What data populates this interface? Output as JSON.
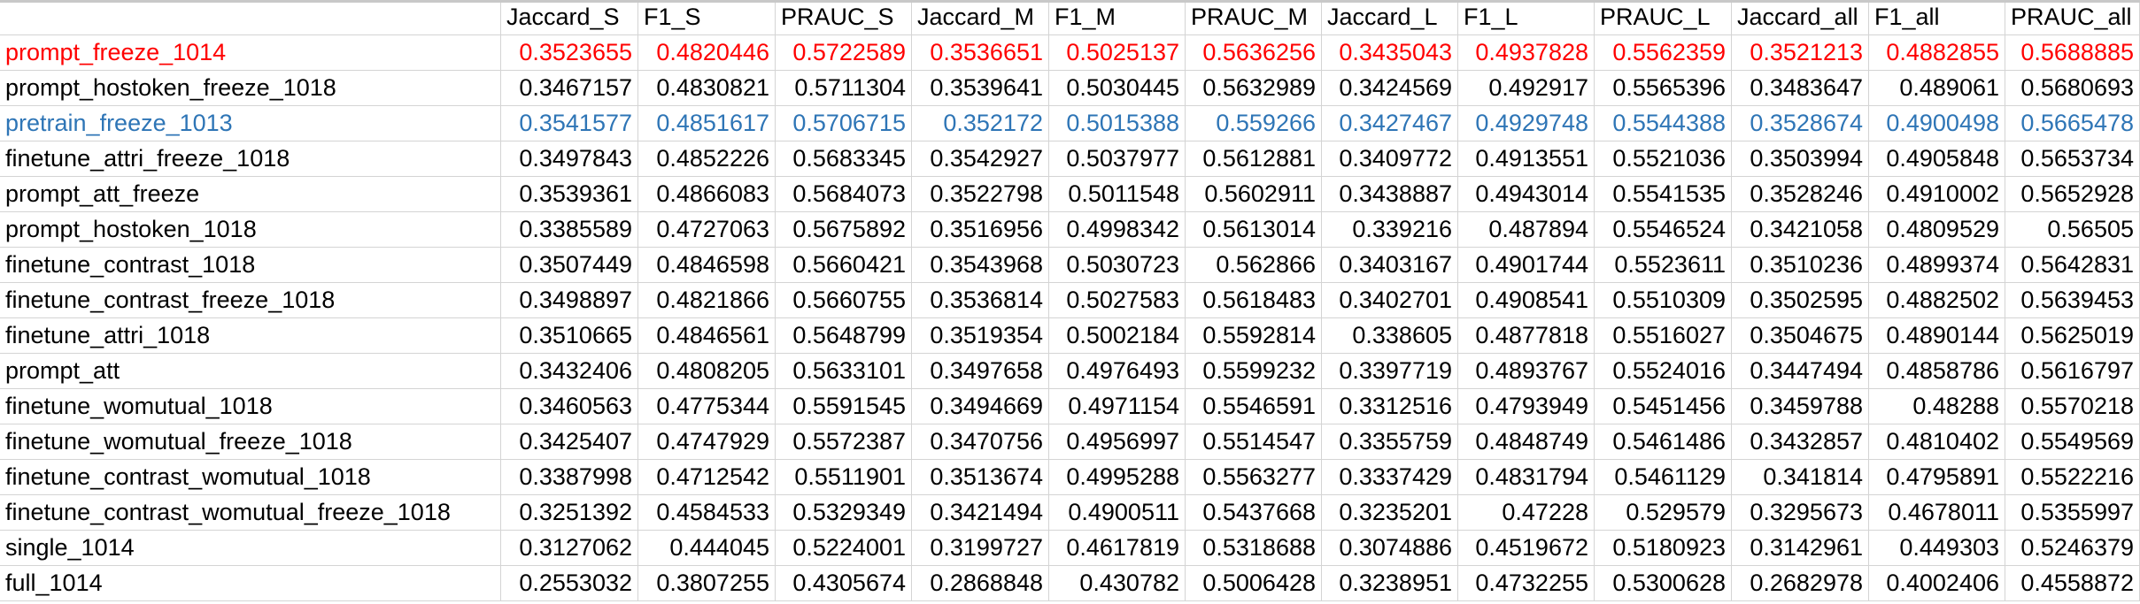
{
  "columns": [
    "Jaccard_S",
    "F1_S",
    "PRAUC_S",
    "Jaccard_M",
    "F1_M",
    "PRAUC_M",
    "Jaccard_L",
    "F1_L",
    "PRAUC_L",
    "Jaccard_all",
    "F1_all",
    "PRAUC_all"
  ],
  "colors": {
    "red": "#ff0000",
    "blue": "#2e75b6",
    "default": "#000000"
  },
  "rows": [
    {
      "name": "prompt_freeze_1014",
      "color": "#ff0000",
      "values": [
        "0.3523655",
        "0.4820446",
        "0.5722589",
        "0.3536651",
        "0.5025137",
        "0.5636256",
        "0.3435043",
        "0.4937828",
        "0.5562359",
        "0.3521213",
        "0.4882855",
        "0.5688885"
      ]
    },
    {
      "name": "prompt_hostoken_freeze_1018",
      "color": "#000000",
      "values": [
        "0.3467157",
        "0.4830821",
        "0.5711304",
        "0.3539641",
        "0.5030445",
        "0.5632989",
        "0.3424569",
        "0.492917",
        "0.5565396",
        "0.3483647",
        "0.489061",
        "0.5680693"
      ]
    },
    {
      "name": "pretrain_freeze_1013",
      "color": "#2e75b6",
      "values": [
        "0.3541577",
        "0.4851617",
        "0.5706715",
        "0.352172",
        "0.5015388",
        "0.559266",
        "0.3427467",
        "0.4929748",
        "0.5544388",
        "0.3528674",
        "0.4900498",
        "0.5665478"
      ]
    },
    {
      "name": "finetune_attri_freeze_1018",
      "color": "#000000",
      "values": [
        "0.3497843",
        "0.4852226",
        "0.5683345",
        "0.3542927",
        "0.5037977",
        "0.5612881",
        "0.3409772",
        "0.4913551",
        "0.5521036",
        "0.3503994",
        "0.4905848",
        "0.5653734"
      ]
    },
    {
      "name": "prompt_att_freeze",
      "color": "#000000",
      "values": [
        "0.3539361",
        "0.4866083",
        "0.5684073",
        "0.3522798",
        "0.5011548",
        "0.5602911",
        "0.3438887",
        "0.4943014",
        "0.5541535",
        "0.3528246",
        "0.4910002",
        "0.5652928"
      ]
    },
    {
      "name": "prompt_hostoken_1018",
      "color": "#000000",
      "values": [
        "0.3385589",
        "0.4727063",
        "0.5675892",
        "0.3516956",
        "0.4998342",
        "0.5613014",
        "0.339216",
        "0.487894",
        "0.5546524",
        "0.3421058",
        "0.4809529",
        "0.56505"
      ]
    },
    {
      "name": "finetune_contrast_1018",
      "color": "#000000",
      "values": [
        "0.3507449",
        "0.4846598",
        "0.5660421",
        "0.3543968",
        "0.5030723",
        "0.562866",
        "0.3403167",
        "0.4901744",
        "0.5523611",
        "0.3510236",
        "0.4899374",
        "0.5642831"
      ]
    },
    {
      "name": "finetune_contrast_freeze_1018",
      "color": "#000000",
      "values": [
        "0.3498897",
        "0.4821866",
        "0.5660755",
        "0.3536814",
        "0.5027583",
        "0.5618483",
        "0.3402701",
        "0.4908541",
        "0.5510309",
        "0.3502595",
        "0.4882502",
        "0.5639453"
      ]
    },
    {
      "name": "finetune_attri_1018",
      "color": "#000000",
      "values": [
        "0.3510665",
        "0.4846561",
        "0.5648799",
        "0.3519354",
        "0.5002184",
        "0.5592814",
        "0.338605",
        "0.4877818",
        "0.5516027",
        "0.3504675",
        "0.4890144",
        "0.5625019"
      ]
    },
    {
      "name": "prompt_att",
      "color": "#000000",
      "values": [
        "0.3432406",
        "0.4808205",
        "0.5633101",
        "0.3497658",
        "0.4976493",
        "0.5599232",
        "0.3397719",
        "0.4893767",
        "0.5524016",
        "0.3447494",
        "0.4858786",
        "0.5616797"
      ]
    },
    {
      "name": "finetune_womutual_1018",
      "color": "#000000",
      "values": [
        "0.3460563",
        "0.4775344",
        "0.5591545",
        "0.3494669",
        "0.4971154",
        "0.5546591",
        "0.3312516",
        "0.4793949",
        "0.5451456",
        "0.3459788",
        "0.48288",
        "0.5570218"
      ]
    },
    {
      "name": "finetune_womutual_freeze_1018",
      "color": "#000000",
      "values": [
        "0.3425407",
        "0.4747929",
        "0.5572387",
        "0.3470756",
        "0.4956997",
        "0.5514547",
        "0.3355759",
        "0.4848749",
        "0.5461486",
        "0.3432857",
        "0.4810402",
        "0.5549569"
      ]
    },
    {
      "name": "finetune_contrast_womutual_1018",
      "color": "#000000",
      "values": [
        "0.3387998",
        "0.4712542",
        "0.5511901",
        "0.3513674",
        "0.4995288",
        "0.5563277",
        "0.3337429",
        "0.4831794",
        "0.5461129",
        "0.341814",
        "0.4795891",
        "0.5522216"
      ]
    },
    {
      "name": "finetune_contrast_womutual_freeze_1018",
      "color": "#000000",
      "values": [
        "0.3251392",
        "0.4584533",
        "0.5329349",
        "0.3421494",
        "0.4900511",
        "0.5437668",
        "0.3235201",
        "0.47228",
        "0.529579",
        "0.3295673",
        "0.4678011",
        "0.5355997"
      ]
    },
    {
      "name": "single_1014",
      "color": "#000000",
      "values": [
        "0.3127062",
        "0.444045",
        "0.5224001",
        "0.3199727",
        "0.4617819",
        "0.5318688",
        "0.3074886",
        "0.4519672",
        "0.5180923",
        "0.3142961",
        "0.449303",
        "0.5246379"
      ]
    },
    {
      "name": "full_1014",
      "color": "#000000",
      "values": [
        "0.2553032",
        "0.3807255",
        "0.4305674",
        "0.2868848",
        "0.430782",
        "0.5006428",
        "0.3238951",
        "0.4732255",
        "0.5300628",
        "0.2682978",
        "0.4002406",
        "0.4558872"
      ]
    }
  ]
}
